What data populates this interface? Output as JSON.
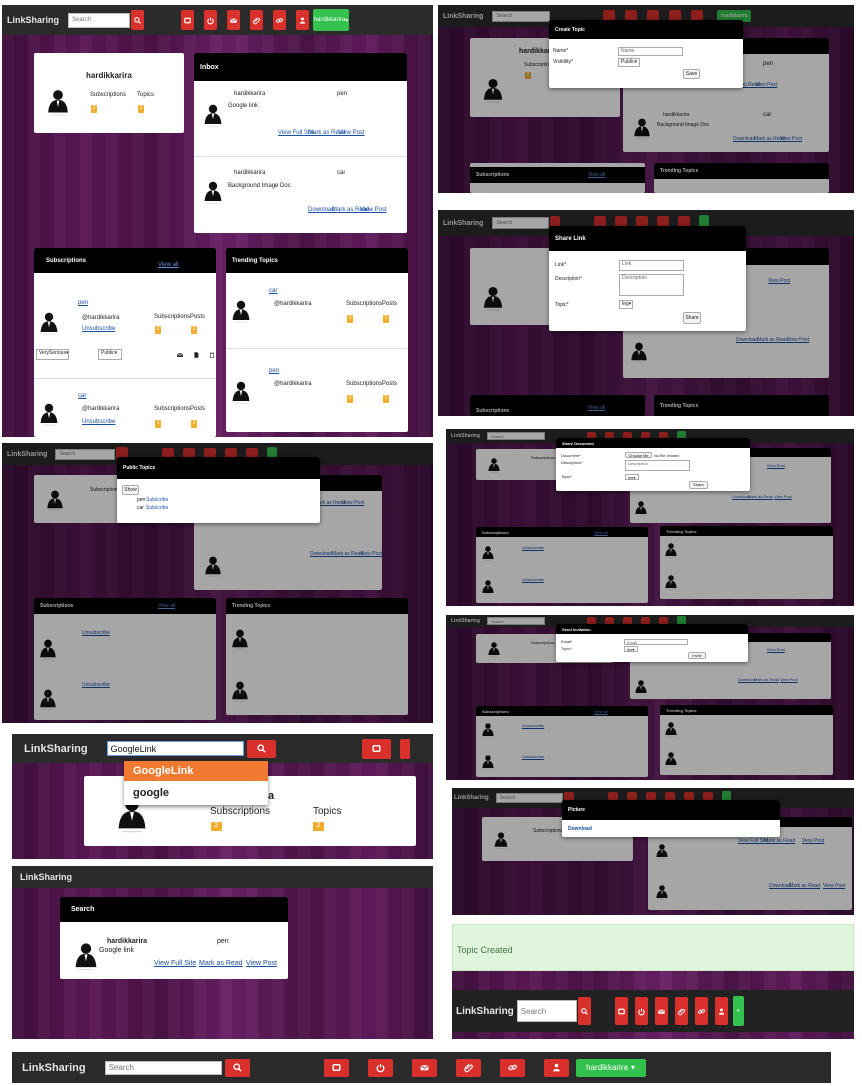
{
  "brand": "LinkSharing",
  "search_placeholder": "Search",
  "user_menu": "hardikkarira",
  "user_menu_caret": "▾",
  "profile": {
    "name": "hardikkarira",
    "subscriptions_label": "Subscriptions",
    "topics_label": "Topics",
    "subscriptions_count": "2",
    "topics_count": "2"
  },
  "inbox": {
    "title": "Inbox",
    "items": [
      {
        "user": "hardikkarira",
        "topic": "pen",
        "text": "Google link",
        "actions": [
          "View Full Site",
          "Mark as Read",
          "View Post"
        ]
      },
      {
        "user": "hardikkarira",
        "topic": "car",
        "text": "Background Image Doc",
        "actions": [
          "Download",
          "Mark as Read",
          "View Post"
        ]
      }
    ]
  },
  "subscriptions": {
    "title": "Subscriptions",
    "view_all": "View all",
    "items": [
      {
        "topic": "pen",
        "user": "@hardikkarira",
        "unsubscribe": "Unsubscribe",
        "sub_label": "Subscriptions",
        "posts_label": "Posts",
        "sub_count": "2",
        "posts_count": "1",
        "seriousness": "VerySerious",
        "visibility": "Public"
      },
      {
        "topic": "car",
        "user": "@hardikkarira",
        "unsubscribe": "Unsubscribe",
        "sub_label": "Subscriptions",
        "posts_label": "Posts",
        "sub_count": "1",
        "posts_count": "1"
      }
    ]
  },
  "trending": {
    "title": "Trending Topics",
    "items": [
      {
        "topic": "car",
        "user": "@hardikkarira",
        "sub_label": "Subscriptions",
        "posts_label": "Posts",
        "sub_count": "1",
        "posts_count": "1"
      },
      {
        "topic": "pen",
        "user": "@hardikkarira",
        "sub_label": "Subscriptions",
        "posts_label": "Posts",
        "sub_count": "2",
        "posts_count": "1"
      }
    ]
  },
  "create_topic": {
    "title": "Create Topic",
    "name_label": "Name*",
    "name_placeholder": "Name",
    "visibility_label": "Visibility*",
    "visibility_value": "Public",
    "save": "Save"
  },
  "share_link": {
    "title": "Share Link",
    "link_label": "Link*",
    "link_placeholder": "Link",
    "desc_label": "Description*",
    "desc_placeholder": "Description",
    "topic_label": "Topic*",
    "topic_value": "leg",
    "share": "Share"
  },
  "public_topics": {
    "title": "Public Topics",
    "show": "Show",
    "items": [
      {
        "name": "pen",
        "action": "Subscribe"
      },
      {
        "name": "car",
        "action": "Subscribe"
      }
    ]
  },
  "share_doc": {
    "title": "Share Document",
    "doc_label": "Document*",
    "choose": "Choose file",
    "no_file": "No file chosen",
    "desc_label": "Description*",
    "desc_placeholder": "Description",
    "topic_label": "Topic*",
    "topic_value": "leg",
    "share": "Share"
  },
  "invite": {
    "title": "Send Invitation",
    "email_label": "Email*",
    "email_placeholder": "Email",
    "topic_label": "Topic*",
    "topic_value": "leg",
    "invite": "Invite"
  },
  "autocomplete": {
    "value": "GoogleLink",
    "options": [
      "GoogleLink",
      "google"
    ],
    "fragment": "a"
  },
  "search_result": {
    "title": "Search",
    "user": "hardikkarira",
    "topic": "pen",
    "text": "Google link",
    "actions": [
      "View Full Site",
      "Mark as Read",
      "View Post"
    ]
  },
  "picture": {
    "title": "Picture",
    "download": "Download"
  },
  "topic_created": "Topic Created",
  "ui": {
    "colors": {
      "nav": "#2b2b2b",
      "red": "#d9302c",
      "green": "#32c24d",
      "badge": "#f0ad2e",
      "link": "#1a4fa3"
    }
  }
}
